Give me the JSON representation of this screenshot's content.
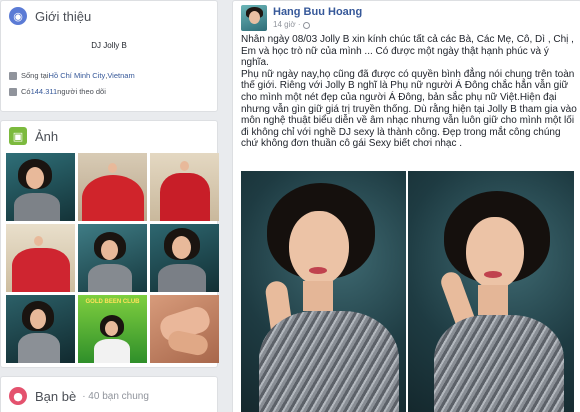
{
  "intro": {
    "title": "Giới thiệu",
    "icon": "globe-icon",
    "name": "DJ Jolly B",
    "lives_prefix": "Sống tại ",
    "lives_city": "Hồ Chí Minh City",
    "lives_sep": ", ",
    "lives_country": "Vietnam",
    "followers_prefix": "Có ",
    "followers_count": "144.311",
    "followers_suffix": " người theo dõi"
  },
  "photos": {
    "title": "Ảnh",
    "icon": "photo-icon",
    "thumbs": [
      {
        "desc": "teal-dress"
      },
      {
        "desc": "red-gown-1"
      },
      {
        "desc": "red-gown-2"
      },
      {
        "desc": "red-gown-3"
      },
      {
        "desc": "teal-dress-2"
      },
      {
        "desc": "teal-dress-3"
      },
      {
        "desc": "teal-dress-4"
      },
      {
        "desc": "gold-been-club"
      },
      {
        "desc": "hands"
      }
    ],
    "thumb_text": "GOLD BEEN CLUB"
  },
  "friends": {
    "title": "Bạn bè",
    "subtitle": "· 40 bạn chung",
    "icon": "friends-icon"
  },
  "post": {
    "author": "Hang Buu Hoang",
    "time": "14 giờ ·",
    "paragraphs": [
      "Nhân ngày 08/03 Jolly B xin kính chúc tất cả các Bà, Các Mẹ, Cô, Dì , Chị , Em và học trò nữ của mình ... Có được một ngày thật hạnh phúc và ý nghĩa.",
      "Phụ nữ ngày nay,họ cũng đã được có quyền bình đẳng nói chung trên toàn thế giới. Riêng với Jolly B nghĩ là Phụ nữ người Á Đông chắc hẳn vẫn giữ cho mình một nét đẹp của người Á Đông, bản sắc phụ nữ Việt.Hiện đại nhưng vẫn gìn giữ giá trị truyền thống. Dù rằng hiện tại Jolly B tham gia vào môn nghệ thuật biểu diễn về âm nhạc nhưng vẫn luôn giữ cho mình một lối đi không chỉ với nghề DJ sexy là thành công. Đẹp trong mắt công chúng chứ không đơn thuần cô gái Sexy biết chơi nhạc ."
    ]
  },
  "colors": {
    "link": "#365899",
    "intro_icon": "#5b7bd5",
    "photo_icon": "#7cba3e",
    "friends_icon": "#e4526e"
  }
}
